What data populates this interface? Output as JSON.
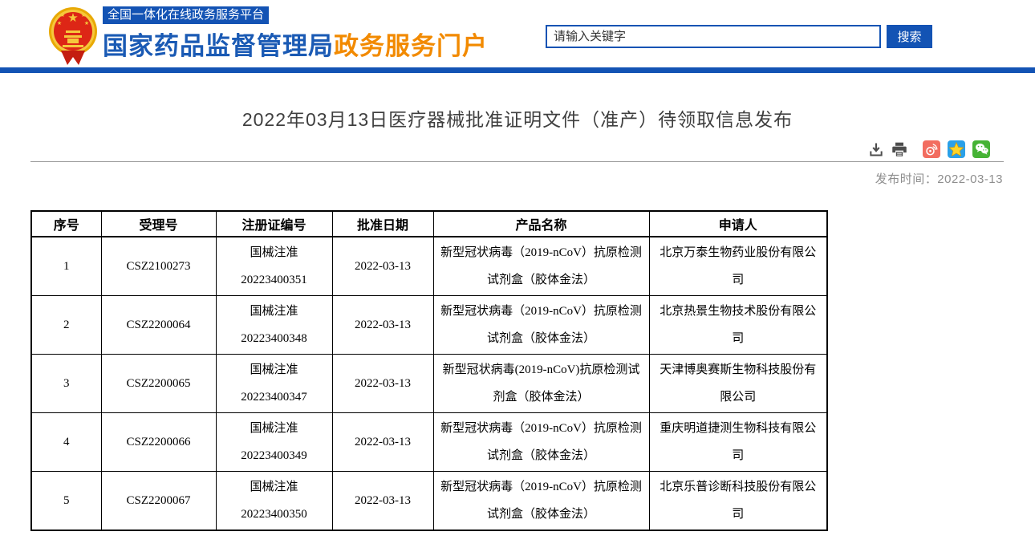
{
  "header": {
    "platform_badge": "全国一体化在线政务服务平台",
    "site_name": "国家药品监督管理局",
    "portal_name": "政务服务门户",
    "search_placeholder": "请输入关键字",
    "search_button": "搜索",
    "colors": {
      "primary_blue": "#1353b4",
      "portal_orange": "#f28a00"
    }
  },
  "page": {
    "title": "2022年03月13日医疗器械批准证明文件（准产）待领取信息发布",
    "publish_label": "发布时间：",
    "publish_date": "2022-03-13",
    "toolbar_icons": [
      "download-icon",
      "print-icon",
      "weibo-icon",
      "qzone-icon",
      "wechat-icon"
    ],
    "icon_colors": {
      "weibo": "#f26d60",
      "qzone": "#2aa0e8",
      "qzone_star": "#ffd428",
      "wechat": "#46b335",
      "tool_gray": "#4d4d4d"
    }
  },
  "table": {
    "headers": [
      "序号",
      "受理号",
      "注册证编号",
      "批准日期",
      "产品名称",
      "申请人"
    ],
    "rows": [
      {
        "seq": "1",
        "acceptance_no": "CSZ2100273",
        "cert_line1": "国械注准",
        "cert_line2": "20223400351",
        "approval_date": "2022-03-13",
        "product_name": "新型冠状病毒（2019-nCoV）抗原检测试剂盒（胶体金法）",
        "applicant": "北京万泰生物药业股份有限公司"
      },
      {
        "seq": "2",
        "acceptance_no": "CSZ2200064",
        "cert_line1": "国械注准",
        "cert_line2": "20223400348",
        "approval_date": "2022-03-13",
        "product_name": "新型冠状病毒（2019-nCoV）抗原检测试剂盒（胶体金法）",
        "applicant": "北京热景生物技术股份有限公司"
      },
      {
        "seq": "3",
        "acceptance_no": "CSZ2200065",
        "cert_line1": "国械注准",
        "cert_line2": "20223400347",
        "approval_date": "2022-03-13",
        "product_name": "新型冠状病毒(2019-nCoV)抗原检测试剂盒（胶体金法）",
        "applicant": "天津博奥赛斯生物科技股份有限公司"
      },
      {
        "seq": "4",
        "acceptance_no": "CSZ2200066",
        "cert_line1": "国械注准",
        "cert_line2": "20223400349",
        "approval_date": "2022-03-13",
        "product_name": "新型冠状病毒（2019-nCoV）抗原检测试剂盒（胶体金法）",
        "applicant": "重庆明道捷测生物科技有限公司"
      },
      {
        "seq": "5",
        "acceptance_no": "CSZ2200067",
        "cert_line1": "国械注准",
        "cert_line2": "20223400350",
        "approval_date": "2022-03-13",
        "product_name": "新型冠状病毒（2019-nCoV）抗原检测试剂盒（胶体金法）",
        "applicant": "北京乐普诊断科技股份有限公司"
      }
    ]
  }
}
